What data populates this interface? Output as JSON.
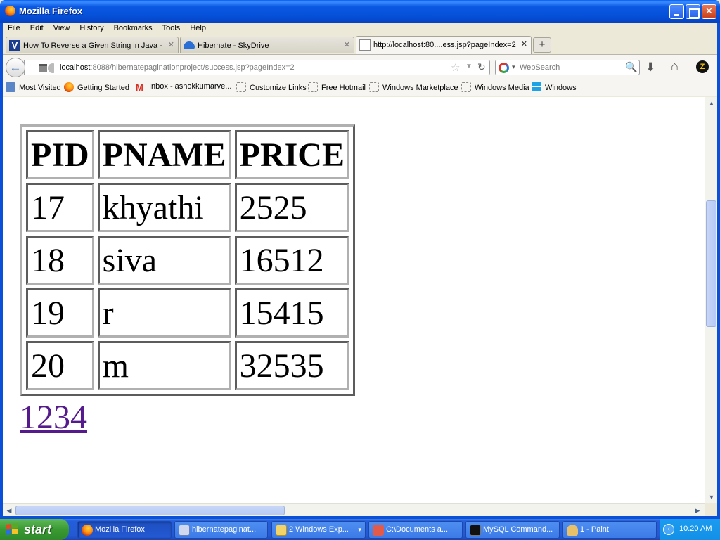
{
  "window": {
    "title": "Mozilla Firefox",
    "buttons": {
      "minimize": "minimize",
      "maximize": "maximize",
      "close": "close"
    }
  },
  "menu": [
    "File",
    "Edit",
    "View",
    "History",
    "Bookmarks",
    "Tools",
    "Help"
  ],
  "tabs": [
    {
      "label": "How To Reverse a Given String in Java - ...",
      "icon": "v-logo-icon"
    },
    {
      "label": "Hibernate - SkyDrive",
      "icon": "skydrive-icon"
    },
    {
      "label": "http://localhost:80....ess.jsp?pageIndex=2",
      "icon": "page-icon"
    }
  ],
  "newtab_label": "+",
  "nav": {
    "url_host": "localhost",
    "url_rest": ":8088/hibernatepaginationproject/success.jsp?pageIndex=2",
    "search_placeholder": "WebSearch"
  },
  "bookmarks": [
    "Most Visited",
    "Getting Started",
    "Inbox - ashokkumarve...",
    "Customize Links",
    "Free Hotmail",
    "Windows Marketplace",
    "Windows Media",
    "Windows"
  ],
  "table": {
    "headers": [
      "PID",
      "PNAME",
      "PRICE"
    ],
    "rows": [
      [
        "17",
        "khyathi",
        "2525"
      ],
      [
        "18",
        "siva",
        "16512"
      ],
      [
        "19",
        "r",
        "15415"
      ],
      [
        "20",
        "m",
        "32535"
      ]
    ]
  },
  "pager": "1234",
  "taskbar": {
    "start": "start",
    "tasks": [
      "Mozilla Firefox",
      "hibernatepaginat...",
      "2 Windows Exp...",
      "C:\\Documents a...",
      "MySQL Command...",
      "1 - Paint"
    ],
    "clock": "10:20 AM"
  }
}
